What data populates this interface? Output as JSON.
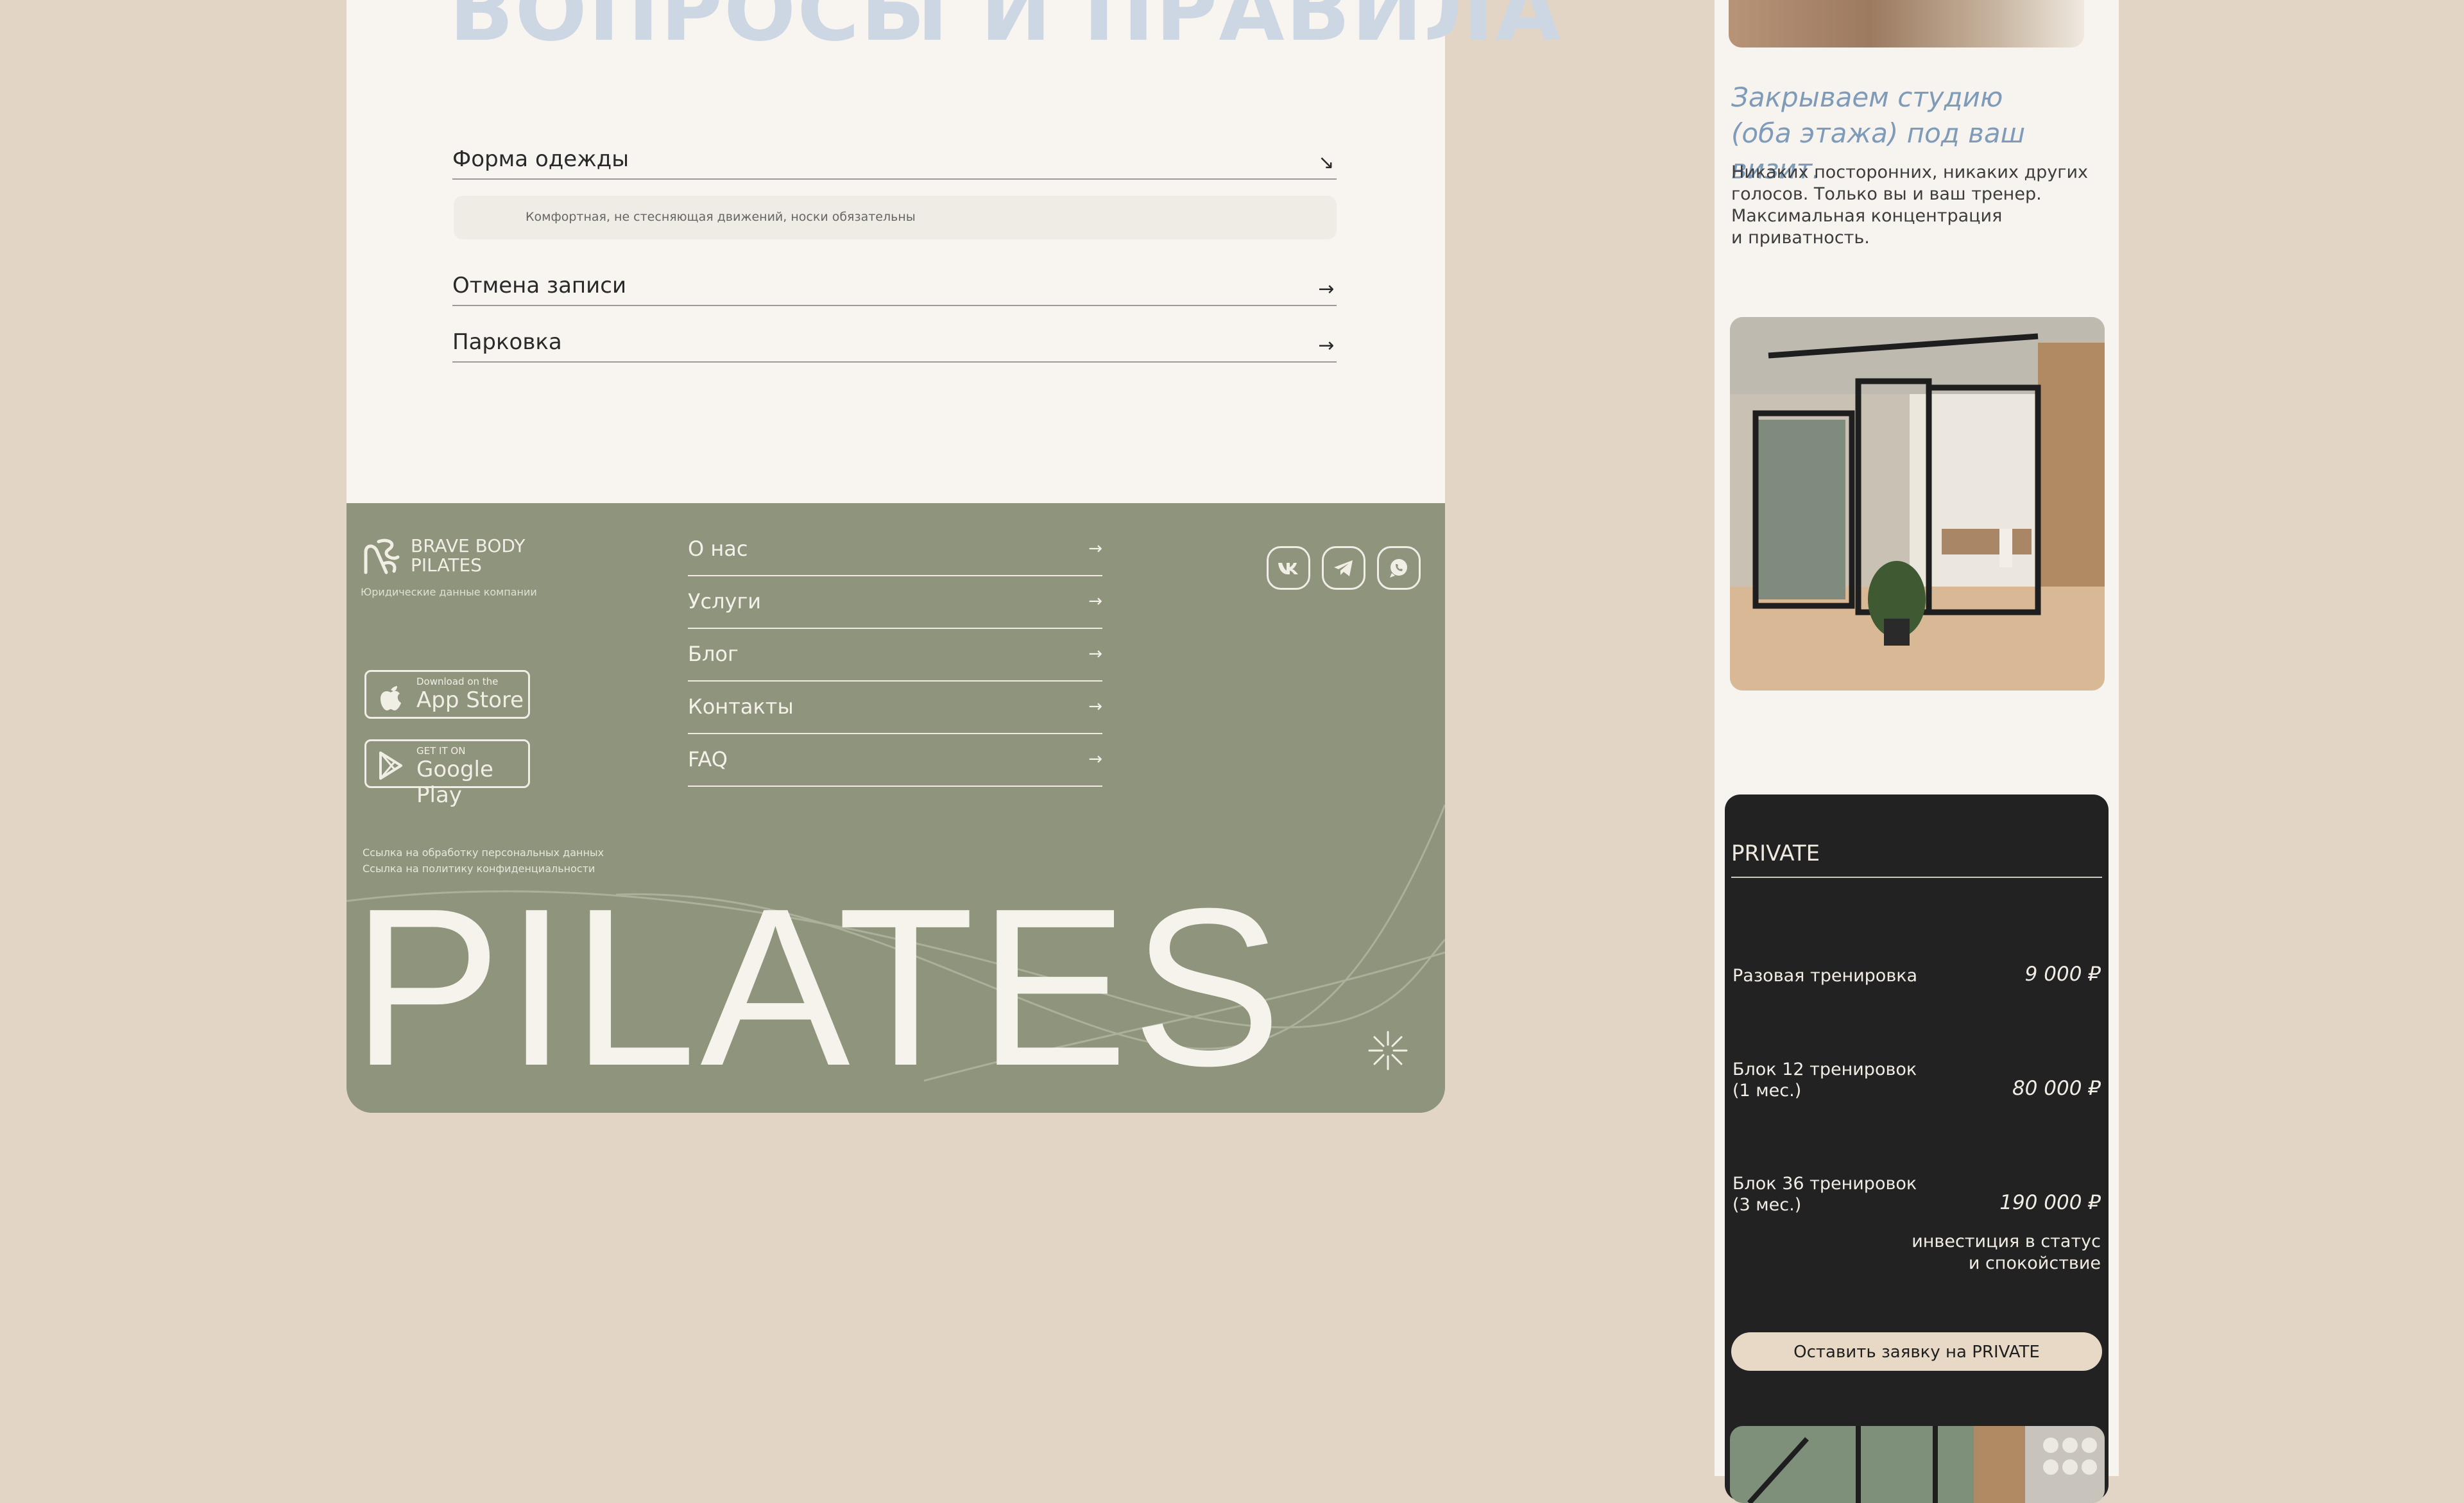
{
  "faq": {
    "title": "ВОПРОСЫ И ПРАВИЛА",
    "items": [
      {
        "label": "Форма одежды",
        "answer": "Комфортная, не стесняющая движений, носки обязательны"
      },
      {
        "label": "Отмена записи"
      },
      {
        "label": "Парковка"
      }
    ],
    "expanded_arrow": "↘",
    "collapsed_arrow": "→"
  },
  "footer": {
    "brand_name": "BRAVE BODY\nPILATES",
    "legal": "Юридические данные компании",
    "app_store": {
      "small": "Download on the",
      "big": "App Store"
    },
    "google_play": {
      "small": "GET IT ON",
      "big": "Google Play"
    },
    "nav": [
      "О нас",
      "Услуги",
      "Блог",
      "Контакты",
      "FAQ"
    ],
    "nav_arrow": "→",
    "social": [
      "vk-icon",
      "telegram-icon",
      "whatsapp-icon"
    ],
    "policy_links": [
      "Ссылка на обработку персональных данных",
      "Ссылка на политику конфиденциальности"
    ],
    "big_word": "PILATES"
  },
  "studio": {
    "heading_lines": [
      "Закрываем студию",
      "(оба этажа) под ваш визит."
    ],
    "text_lines": [
      "Никаких посторонних, никаких других",
      "голосов. Только вы и ваш тренер.",
      "Максимальная концентрация",
      "и приватность."
    ]
  },
  "private": {
    "title": "PRIVATE",
    "prices": [
      {
        "label": "Разовая тренировка",
        "value": "9 000 ₽"
      },
      {
        "label": "Блок 12 тренировок\n(1 мес.)",
        "value": "80 000 ₽"
      },
      {
        "label": "Блок 36 тренировок\n(3 мес.)",
        "value": "190 000 ₽"
      }
    ],
    "note": "инвестиция в статус\nи спокойствие",
    "button": "Оставить заявку на PRIVATE"
  },
  "colors": {
    "page_bg": "#e3d5c5",
    "footer_green": "#8e957c",
    "heading_blue": "#7e9bb9",
    "card_dark": "#222222",
    "button_beige": "#e8d9c7"
  }
}
